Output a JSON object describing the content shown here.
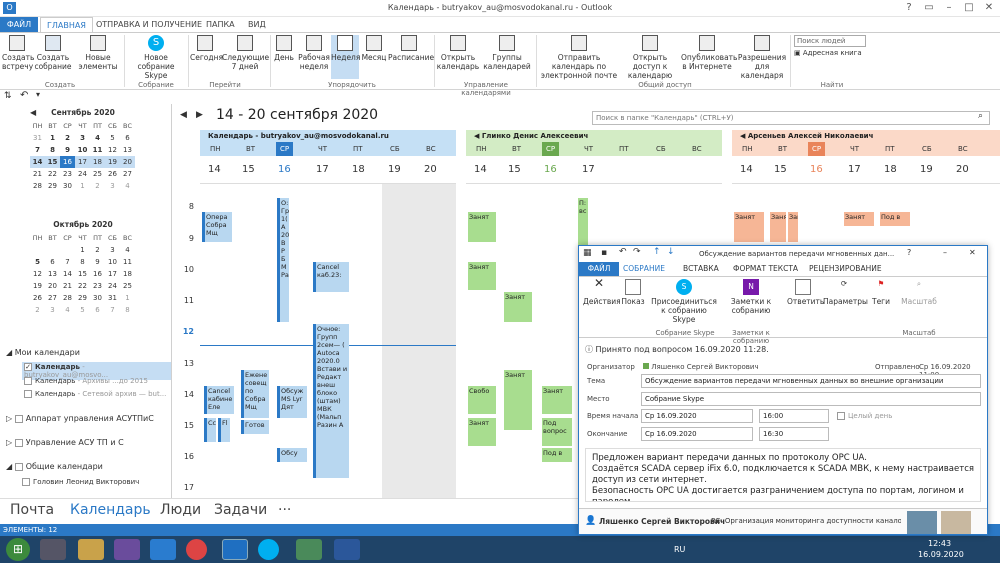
{
  "window": {
    "title": "Календарь - butryakov_au@mosvodokanal.ru - Outlook"
  },
  "ribbon_tabs": [
    "ФАЙЛ",
    "ГЛАВНАЯ",
    "ОТПРАВКА И ПОЛУЧЕНИЕ",
    "ПАПКА",
    "ВИД"
  ],
  "ribbon": {
    "new_meeting": "Создать встречу",
    "new_conf": "Создать собрание",
    "new_items": "Новые элементы",
    "skype_meeting": "Новое собрание Skype",
    "today": "Сегодня",
    "next7": "Следующие 7 дней",
    "day": "День",
    "workweek": "Рабочая неделя",
    "week": "Неделя",
    "month": "Месяц",
    "schedule": "Расписание",
    "open_cal": "Открыть календарь",
    "cal_groups": "Группы календарей",
    "send_email": "Отправить календарь по электронной почте",
    "share": "Открыть доступ к календарю",
    "publish": "Опубликовать в Интернете",
    "permissions": "Разрешения для календаря",
    "search_people": "Поиск людей",
    "address_book": "Адресная книга",
    "groups": {
      "create": "Создать",
      "skype": "Собрание Skype",
      "goto": "Перейти",
      "arrange": "Упорядочить",
      "manage": "Управление календарями",
      "share": "Общий доступ",
      "find": "Найти"
    }
  },
  "nav": {
    "range": "14 - 20 сентября 2020",
    "search_placeholder": "Поиск в папке \"Календарь\" (CTRL+У)"
  },
  "mini_cal": {
    "weekdays": [
      "ПН",
      "ВТ",
      "СР",
      "ЧТ",
      "ПТ",
      "СБ",
      "ВС"
    ],
    "sep": {
      "title": "Сентябрь 2020",
      "weeks": [
        [
          "31",
          "1",
          "2",
          "3",
          "4",
          "5",
          "6"
        ],
        [
          "7",
          "8",
          "9",
          "10",
          "11",
          "12",
          "13"
        ],
        [
          "14",
          "15",
          "16",
          "17",
          "18",
          "19",
          "20"
        ],
        [
          "21",
          "22",
          "23",
          "24",
          "25",
          "26",
          "27"
        ],
        [
          "28",
          "29",
          "30",
          "1",
          "2",
          "3",
          "4"
        ]
      ]
    },
    "oct": {
      "title": "Октябрь 2020",
      "weeks": [
        [
          "",
          "",
          "",
          "1",
          "2",
          "3",
          "4"
        ],
        [
          "5",
          "6",
          "7",
          "8",
          "9",
          "10",
          "11"
        ],
        [
          "12",
          "13",
          "14",
          "15",
          "16",
          "17",
          "18"
        ],
        [
          "19",
          "20",
          "21",
          "22",
          "23",
          "24",
          "25"
        ],
        [
          "26",
          "27",
          "28",
          "29",
          "30",
          "31",
          "1"
        ],
        [
          "2",
          "3",
          "4",
          "5",
          "6",
          "7",
          "8"
        ]
      ]
    }
  },
  "folders": {
    "my": "Мои календари",
    "items": [
      {
        "name": "Календарь",
        "sub": "- butryakov_au@mosvo..."
      },
      {
        "name": "Календарь",
        "sub": "- Архивы ...до 2015"
      },
      {
        "name": "Календарь",
        "sub": "- Сетевой архив — but..."
      }
    ],
    "g1": "Аппарат управления АСУТПиС",
    "g2": "Управление АСУ ТП и С",
    "g3": "Общие календари",
    "shared_item": "Головин Леонид Викторович"
  },
  "panels": [
    {
      "title": "Календарь - butryakov_au@mosvodokanal.ru",
      "color": "#2b79c6",
      "bg": "#c5e0f5"
    },
    {
      "title": "Глинко Денис Алексеевич",
      "color": "#6aa84f",
      "bg": "#d3ecc5"
    },
    {
      "title": "Арсеньев Алексей Николаевич",
      "color": "#e9845a",
      "bg": "#fbd9c8"
    }
  ],
  "weekdays": [
    "ПН",
    "ВТ",
    "СР",
    "ЧТ",
    "ПТ",
    "СБ",
    "ВС"
  ],
  "daynums": [
    "14",
    "15",
    "16",
    "17",
    "18",
    "19",
    "20"
  ],
  "hours": [
    "8",
    "9",
    "10",
    "11",
    "12",
    "13",
    "14",
    "15",
    "16",
    "17"
  ],
  "events": {
    "e1": "Опера Собра Мщ",
    "e2": "О: Гр 1( А 20 В Р Б М Ра",
    "e3": "Cancel каб.23: ",
    "e4": "Очное: Групп 2сем— ( Autoca 2020.0 Встави и Редакт внеш блоко (штам) МВК (Мальп Разин А",
    "e5": "Cancel кабине Еле",
    "e6": "Ежене совещ по Собра Мщ",
    "e7": "Обсуж MS Lyr Дят",
    "e8": "Готов",
    "e9": "Обсу",
    "e10": "Сс",
    "e11": "Fl",
    "e12": "Сс",
    "busy": "Занят",
    "free": "Свобо",
    "tentative": "Под вопрос",
    "pv": "Под в",
    "pa": "П: вс"
  },
  "meeting": {
    "title": "Обсуждение вариантов передачи мгновенных дан...",
    "tabs": [
      "ФАЙЛ",
      "СОБРАНИЕ",
      "ВСТАВКА",
      "ФОРМАТ ТЕКСТА",
      "РЕЦЕНЗИРОВАНИЕ"
    ],
    "actions": "Действия",
    "show": "Показ",
    "join_skype": "Присоединиться к собранию Skype",
    "notes": "Заметки к собранию",
    "reply": "Ответить",
    "params": "Параметры",
    "tags": "Теги",
    "zoom": "Масштаб",
    "group_skype": "Собрание Skype",
    "group_notes": "Заметки к собранию",
    "group_zoom": "Масштаб",
    "accepted": "Принято под вопросом 16.09.2020 11:28.",
    "organizer_label": "Организатор",
    "organizer": "Ляшенко Сергей Викторович",
    "sent_label": "Отправлено",
    "sent": "Ср 16.09.2020 11:00",
    "subject_label": "Тема",
    "subject": "Обсуждение вариантов передачи мгновенных данных во внешние организации",
    "location_label": "Место",
    "location": "Собрание Skype",
    "start_label": "Время начала",
    "start_date": "Ср 16.09.2020",
    "start_time": "16:00",
    "allday": "Целый день",
    "end_label": "Окончание",
    "end_date": "Ср 16.09.2020",
    "end_time": "16:30",
    "body": [
      "Предложен вариант передачи данных по протоколу OPC UA.",
      "Создаётся SCADA сервер iFix 6.0, подключается к SCADA МВК,  к нему настраивается доступ из сети интернет.",
      "Безопасность OPC UA достигается разграничением доступа по портам, логином и паролем,"
    ],
    "footer_name": "Ляшенко Сергей Викторович",
    "footer_text": "RE: Организация мониторинга доступности каналов связи"
  },
  "bottom_nav": [
    "Почта",
    "Календарь",
    "Люди",
    "Задачи",
    "···"
  ],
  "status": "ЭЛЕМЕНТЫ: 12",
  "taskbar": {
    "lang": "RU",
    "time": "12:43",
    "date": "16.09.2020"
  }
}
